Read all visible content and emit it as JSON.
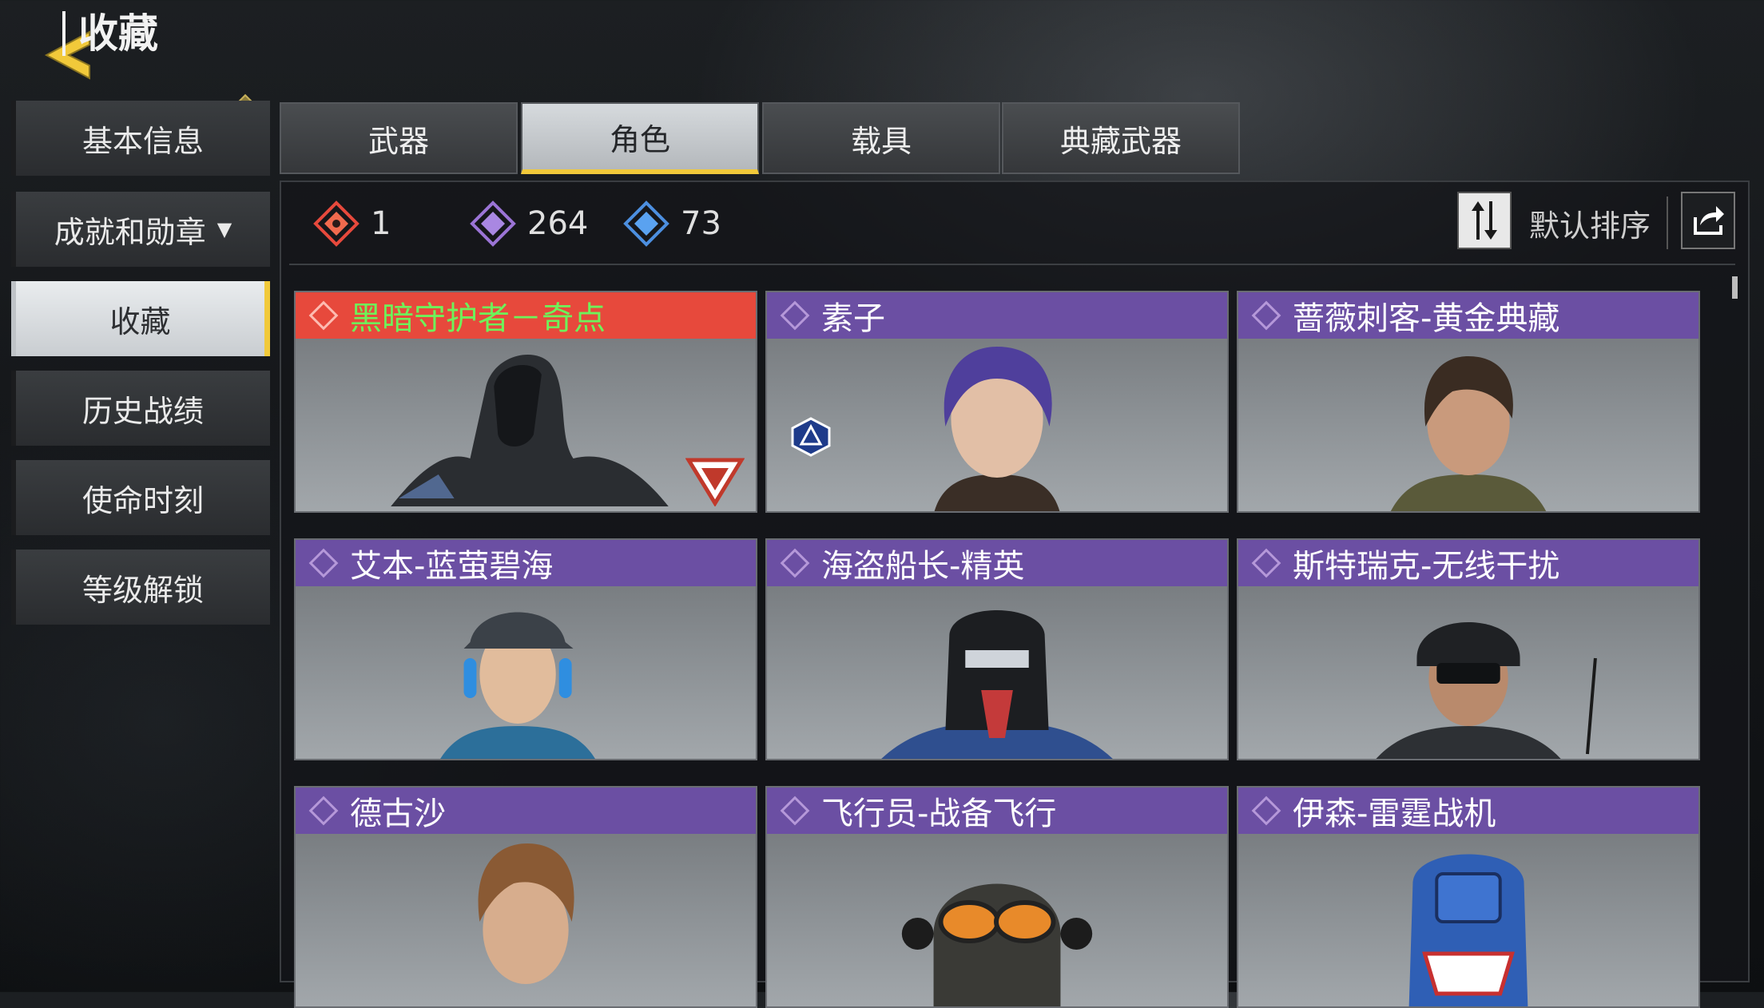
{
  "header": {
    "title": "收藏"
  },
  "sidebar": {
    "items": [
      {
        "label": "基本信息"
      },
      {
        "label": "成就和勋章"
      },
      {
        "label": "收藏"
      },
      {
        "label": "历史战绩"
      },
      {
        "label": "使命时刻"
      },
      {
        "label": "等级解锁"
      }
    ]
  },
  "tabs": [
    {
      "label": "武器"
    },
    {
      "label": "角色"
    },
    {
      "label": "载具"
    },
    {
      "label": "典藏武器"
    }
  ],
  "stats": {
    "legendary": "1",
    "epic": "264",
    "rare": "73"
  },
  "sort": {
    "label": "默认排序"
  },
  "cards": [
    {
      "name": "黑暗守护者－奇点",
      "rarity": "legendary"
    },
    {
      "name": "素子",
      "rarity": "epic"
    },
    {
      "name": "蔷薇刺客-黄金典藏",
      "rarity": "epic"
    },
    {
      "name": "艾本-蓝萤碧海",
      "rarity": "epic"
    },
    {
      "name": "海盗船长-精英",
      "rarity": "epic"
    },
    {
      "name": "斯特瑞克-无线干扰",
      "rarity": "epic"
    },
    {
      "name": "德古沙",
      "rarity": "epic"
    },
    {
      "name": "飞行员-战备飞行",
      "rarity": "epic"
    },
    {
      "name": "伊森-雷霆战机",
      "rarity": "epic"
    }
  ],
  "colors": {
    "accent": "#f1c93a",
    "legendary_header": "#e7493c",
    "legendary_text": "#6ef25a",
    "epic_header": "#6b4fa3"
  }
}
